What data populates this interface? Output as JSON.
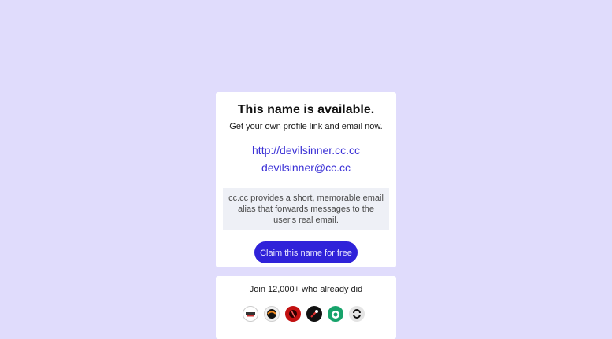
{
  "main": {
    "title": "This name is available.",
    "subtitle": "Get your own profile link and email now.",
    "profile_link": "http://devilsinner.cc.cc",
    "email": "devilsinner@cc.cc",
    "info": "cc.cc provides a short, memorable email alias that forwards messages to the user's real email.",
    "claim_button": "Claim this name for free"
  },
  "join": {
    "text": "Join 12,000+ who already did",
    "avatars": [
      "avatar-1",
      "avatar-2",
      "avatar-3",
      "avatar-4",
      "avatar-5",
      "avatar-6"
    ]
  },
  "colors": {
    "background": "#e0dcfc",
    "link": "#3b31d6",
    "button": "#2f22d9"
  }
}
